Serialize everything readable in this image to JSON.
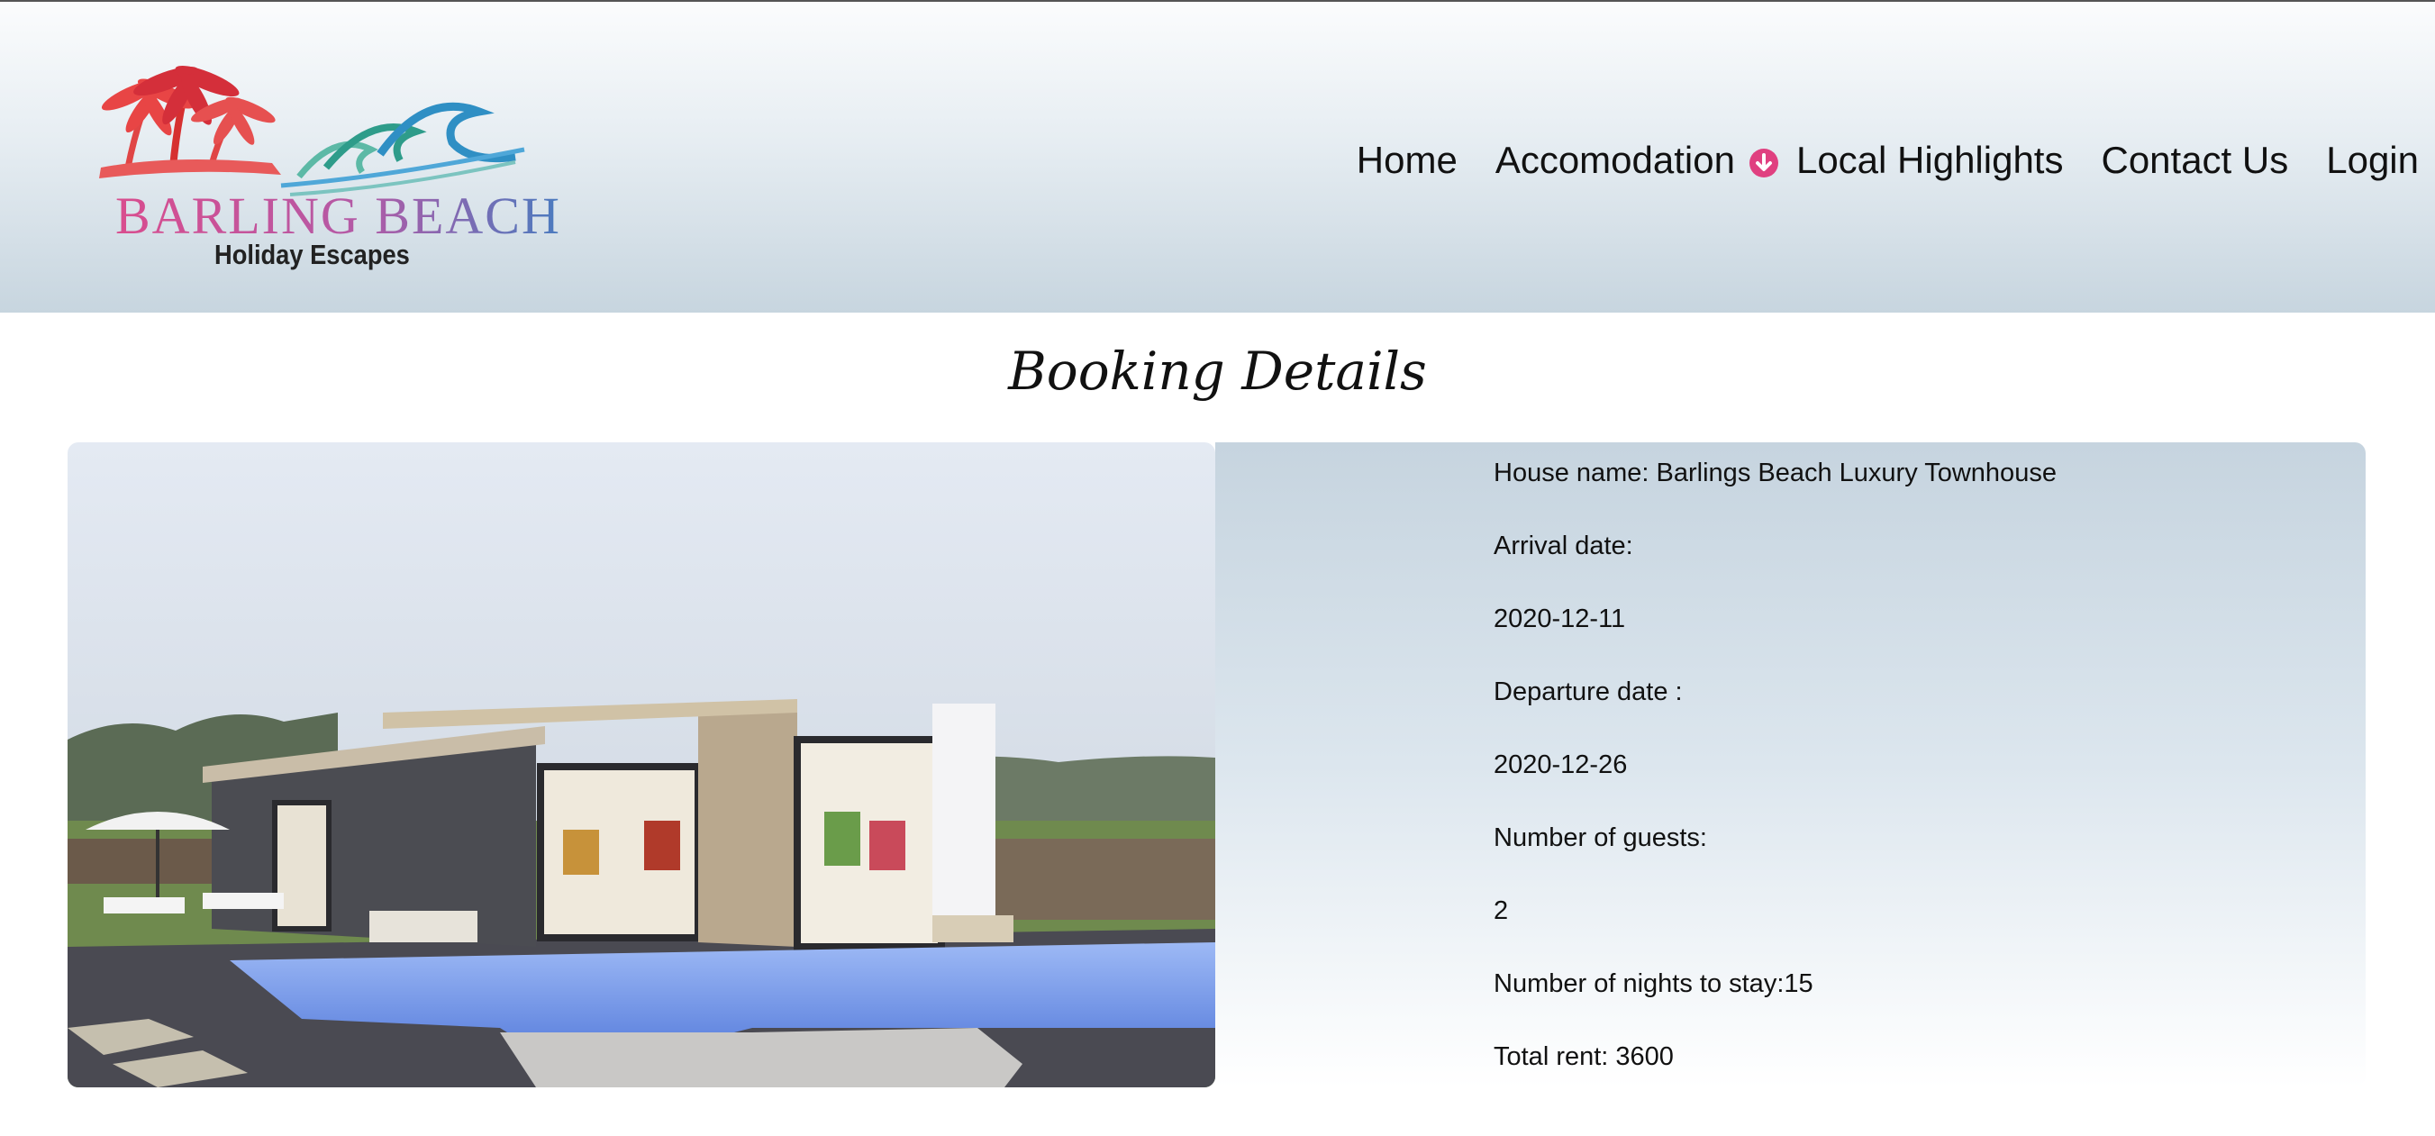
{
  "brand": {
    "name": "BARLING BEACH",
    "tagline": "Holiday Escapes"
  },
  "nav": {
    "items": [
      "Home",
      "Accomodation",
      "Local Highlights",
      "Contact Us",
      "Login"
    ],
    "dropdown_icon": "chevron-down-circle-icon",
    "accent_color": "#e04080"
  },
  "page": {
    "title": "Booking Details"
  },
  "booking": {
    "house_line": "House name: Barlings Beach Luxury Townhouse",
    "arrival_label": "Arrival date:",
    "arrival_value": "2020-12-11",
    "departure_label": "Departure date :",
    "departure_value": "2020-12-26",
    "guests_label": "Number of guests:",
    "guests_value": "2",
    "nights_line": "Number of nights to stay:15",
    "rent_line": "Total rent: 3600"
  },
  "colors": {
    "header_top": "#fbfcfd",
    "header_bottom": "#c7d5df",
    "details_top": "#c6d4df",
    "pool": "#7fa4f0"
  }
}
